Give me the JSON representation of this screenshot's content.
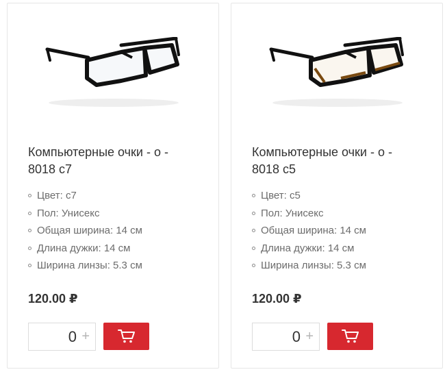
{
  "products": [
    {
      "image_icon": "glasses-black-frame-icon",
      "title": "Компьютерные очки - о - 8018 с7",
      "specs": [
        "Цвет: с7",
        "Пол: Унисекс",
        "Общая ширина: 14 см",
        "Длина дужки: 14 см",
        "Ширина линзы: 5.3 см"
      ],
      "price": "120.00 ₽",
      "quantity": "0",
      "plus_label": "+",
      "cart_icon": "cart-icon"
    },
    {
      "image_icon": "glasses-brown-frame-icon",
      "title": "Компьютерные очки - о - 8018 с5",
      "specs": [
        "Цвет: с5",
        "Пол: Унисекс",
        "Общая ширина: 14 см",
        "Длина дужки: 14 см",
        "Ширина линзы: 5.3 см"
      ],
      "price": "120.00 ₽",
      "quantity": "0",
      "plus_label": "+",
      "cart_icon": "cart-icon"
    }
  ],
  "colors": {
    "accent": "#d7282f",
    "frame_dark": "#111111",
    "frame_brown": "#7a4a10"
  }
}
